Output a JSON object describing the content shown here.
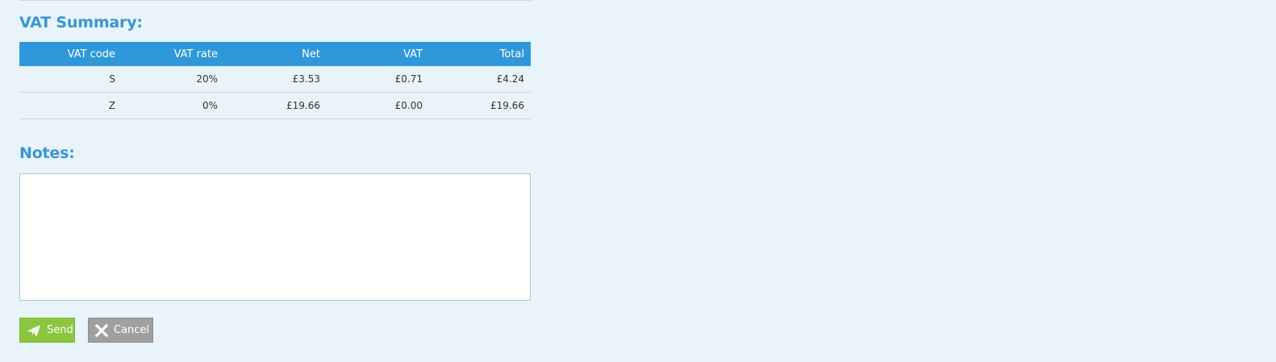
{
  "vat_summary": {
    "title": "VAT Summary:",
    "columns": [
      "VAT code",
      "VAT rate",
      "Net",
      "VAT",
      "Total"
    ],
    "rows": [
      [
        "S",
        "20%",
        "£3.53",
        "£0.71",
        "£4.24"
      ],
      [
        "Z",
        "0%",
        "£19.66",
        "£0.00",
        "£19.66"
      ]
    ]
  },
  "notes": {
    "title": "Notes:",
    "value": "",
    "placeholder": ""
  },
  "actions": {
    "send_label": "Send",
    "send_icon": "paper-plane-icon",
    "cancel_label": "Cancel",
    "cancel_icon": "close-icon"
  },
  "colors": {
    "accent": "#2f98da",
    "title": "#3a96d2",
    "background": "#e8f3fa",
    "send_button": "#8cc63f",
    "cancel_button": "#a0a0a0"
  }
}
